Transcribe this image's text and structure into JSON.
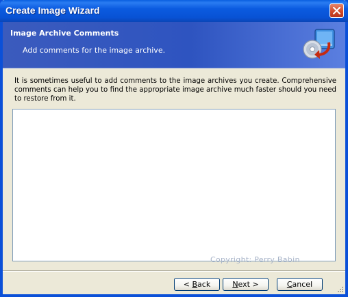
{
  "window": {
    "title": "Create Image Wizard"
  },
  "header": {
    "title": "Image Archive Comments",
    "subtitle": "Add comments for the image archive.",
    "icon": "disk-restore-icon"
  },
  "content": {
    "description": "It is sometimes useful to add comments to the image archives you create. Comprehensive comments can help you to find the appropriate image archive much faster should you need to restore from it.",
    "comment_value": "",
    "watermark": "Copyright: Perry Babin"
  },
  "buttons": {
    "back": {
      "prefix": "< ",
      "accel": "B",
      "rest": "ack"
    },
    "next": {
      "accel": "N",
      "rest": "ext >"
    },
    "cancel": {
      "accel": "C",
      "rest": "ancel"
    }
  },
  "colors": {
    "titlebar": "#0b5be0",
    "header": "#2e54c0",
    "face": "#ece9d8"
  }
}
